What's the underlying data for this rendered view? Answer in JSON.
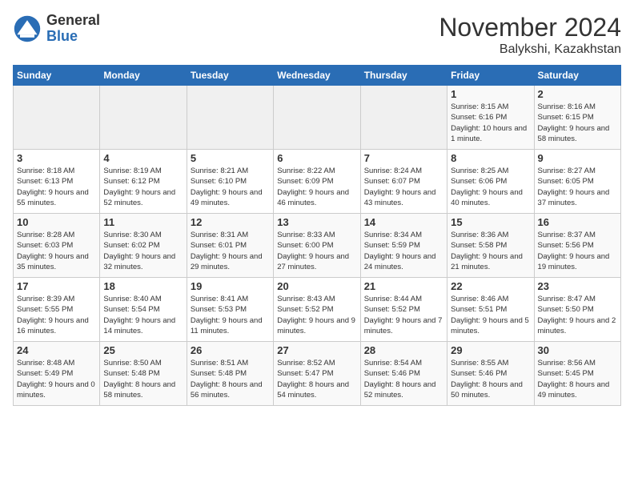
{
  "logo": {
    "general": "General",
    "blue": "Blue"
  },
  "header": {
    "month": "November 2024",
    "location": "Balykshi, Kazakhstan"
  },
  "weekdays": [
    "Sunday",
    "Monday",
    "Tuesday",
    "Wednesday",
    "Thursday",
    "Friday",
    "Saturday"
  ],
  "weeks": [
    [
      {
        "day": "",
        "info": ""
      },
      {
        "day": "",
        "info": ""
      },
      {
        "day": "",
        "info": ""
      },
      {
        "day": "",
        "info": ""
      },
      {
        "day": "",
        "info": ""
      },
      {
        "day": "1",
        "info": "Sunrise: 8:15 AM\nSunset: 6:16 PM\nDaylight: 10 hours and 1 minute."
      },
      {
        "day": "2",
        "info": "Sunrise: 8:16 AM\nSunset: 6:15 PM\nDaylight: 9 hours and 58 minutes."
      }
    ],
    [
      {
        "day": "3",
        "info": "Sunrise: 8:18 AM\nSunset: 6:13 PM\nDaylight: 9 hours and 55 minutes."
      },
      {
        "day": "4",
        "info": "Sunrise: 8:19 AM\nSunset: 6:12 PM\nDaylight: 9 hours and 52 minutes."
      },
      {
        "day": "5",
        "info": "Sunrise: 8:21 AM\nSunset: 6:10 PM\nDaylight: 9 hours and 49 minutes."
      },
      {
        "day": "6",
        "info": "Sunrise: 8:22 AM\nSunset: 6:09 PM\nDaylight: 9 hours and 46 minutes."
      },
      {
        "day": "7",
        "info": "Sunrise: 8:24 AM\nSunset: 6:07 PM\nDaylight: 9 hours and 43 minutes."
      },
      {
        "day": "8",
        "info": "Sunrise: 8:25 AM\nSunset: 6:06 PM\nDaylight: 9 hours and 40 minutes."
      },
      {
        "day": "9",
        "info": "Sunrise: 8:27 AM\nSunset: 6:05 PM\nDaylight: 9 hours and 37 minutes."
      }
    ],
    [
      {
        "day": "10",
        "info": "Sunrise: 8:28 AM\nSunset: 6:03 PM\nDaylight: 9 hours and 35 minutes."
      },
      {
        "day": "11",
        "info": "Sunrise: 8:30 AM\nSunset: 6:02 PM\nDaylight: 9 hours and 32 minutes."
      },
      {
        "day": "12",
        "info": "Sunrise: 8:31 AM\nSunset: 6:01 PM\nDaylight: 9 hours and 29 minutes."
      },
      {
        "day": "13",
        "info": "Sunrise: 8:33 AM\nSunset: 6:00 PM\nDaylight: 9 hours and 27 minutes."
      },
      {
        "day": "14",
        "info": "Sunrise: 8:34 AM\nSunset: 5:59 PM\nDaylight: 9 hours and 24 minutes."
      },
      {
        "day": "15",
        "info": "Sunrise: 8:36 AM\nSunset: 5:58 PM\nDaylight: 9 hours and 21 minutes."
      },
      {
        "day": "16",
        "info": "Sunrise: 8:37 AM\nSunset: 5:56 PM\nDaylight: 9 hours and 19 minutes."
      }
    ],
    [
      {
        "day": "17",
        "info": "Sunrise: 8:39 AM\nSunset: 5:55 PM\nDaylight: 9 hours and 16 minutes."
      },
      {
        "day": "18",
        "info": "Sunrise: 8:40 AM\nSunset: 5:54 PM\nDaylight: 9 hours and 14 minutes."
      },
      {
        "day": "19",
        "info": "Sunrise: 8:41 AM\nSunset: 5:53 PM\nDaylight: 9 hours and 11 minutes."
      },
      {
        "day": "20",
        "info": "Sunrise: 8:43 AM\nSunset: 5:52 PM\nDaylight: 9 hours and 9 minutes."
      },
      {
        "day": "21",
        "info": "Sunrise: 8:44 AM\nSunset: 5:52 PM\nDaylight: 9 hours and 7 minutes."
      },
      {
        "day": "22",
        "info": "Sunrise: 8:46 AM\nSunset: 5:51 PM\nDaylight: 9 hours and 5 minutes."
      },
      {
        "day": "23",
        "info": "Sunrise: 8:47 AM\nSunset: 5:50 PM\nDaylight: 9 hours and 2 minutes."
      }
    ],
    [
      {
        "day": "24",
        "info": "Sunrise: 8:48 AM\nSunset: 5:49 PM\nDaylight: 9 hours and 0 minutes."
      },
      {
        "day": "25",
        "info": "Sunrise: 8:50 AM\nSunset: 5:48 PM\nDaylight: 8 hours and 58 minutes."
      },
      {
        "day": "26",
        "info": "Sunrise: 8:51 AM\nSunset: 5:48 PM\nDaylight: 8 hours and 56 minutes."
      },
      {
        "day": "27",
        "info": "Sunrise: 8:52 AM\nSunset: 5:47 PM\nDaylight: 8 hours and 54 minutes."
      },
      {
        "day": "28",
        "info": "Sunrise: 8:54 AM\nSunset: 5:46 PM\nDaylight: 8 hours and 52 minutes."
      },
      {
        "day": "29",
        "info": "Sunrise: 8:55 AM\nSunset: 5:46 PM\nDaylight: 8 hours and 50 minutes."
      },
      {
        "day": "30",
        "info": "Sunrise: 8:56 AM\nSunset: 5:45 PM\nDaylight: 8 hours and 49 minutes."
      }
    ]
  ]
}
